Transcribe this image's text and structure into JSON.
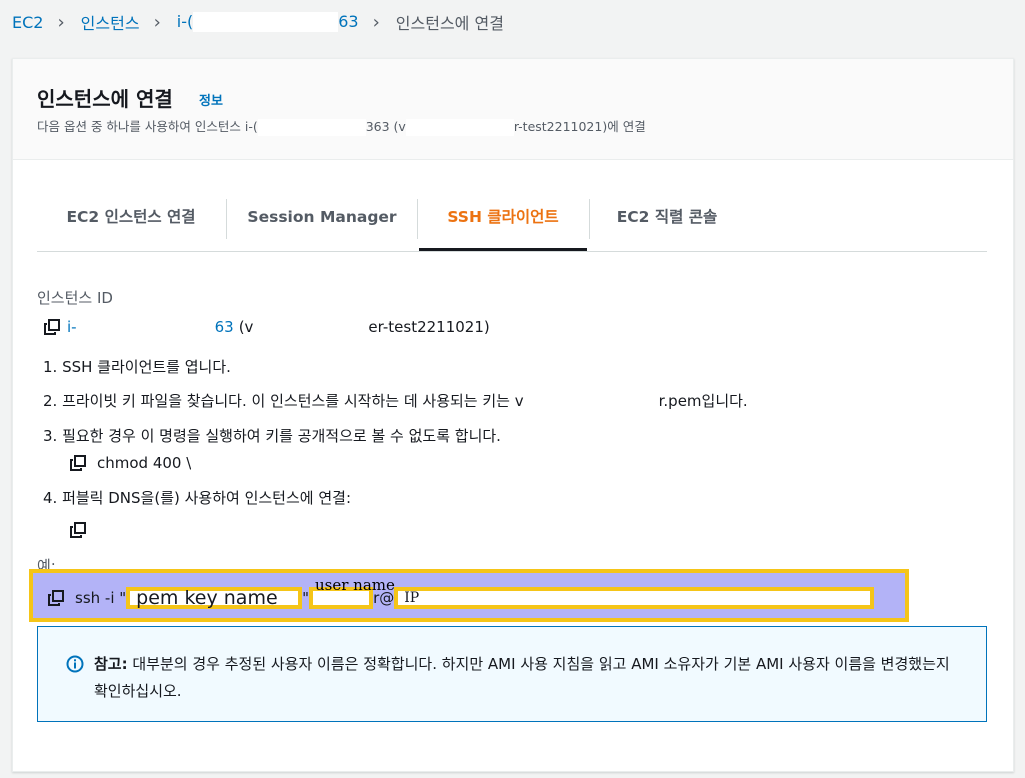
{
  "breadcrumb": {
    "ec2": "EC2",
    "instances": "인스턴스",
    "instance_id": "i-(",
    "instance_id_end": "63",
    "current": "인스턴스에 연결"
  },
  "header": {
    "title": "인스턴스에 연결",
    "info": "정보",
    "subtitle_start": "다음 옵션 중 하나를 사용하여 인스턴스 i-(",
    "subtitle_mid": "363 (v",
    "subtitle_end": "r-test2211021)에 연결"
  },
  "tabs": [
    {
      "label": "EC2 인스턴스 연결"
    },
    {
      "label": "Session Manager"
    },
    {
      "label": "SSH 클라이언트"
    },
    {
      "label": "EC2 직렬 콘솔"
    }
  ],
  "instance": {
    "label": "인스턴스 ID",
    "id_start": "i-",
    "id_end": "63",
    "name_start": "(v",
    "name_end": "er-test2211021)"
  },
  "steps": {
    "s1": "1. SSH 클라이언트를 엽니다.",
    "s2_start": "2. 프라이빗 키 파일을 찾습니다. 이 인스턴스를 시작하는 데 사용되는 키는 v",
    "s2_end": "r.pem입니다.",
    "s3": "3. 필요한 경우 이 명령을 실행하여 키를 공개적으로 볼 수 없도록 합니다.",
    "s3_cmd": "chmod 400 \\",
    "s4": "4. 퍼블릭 DNS을(를) 사용하여 인스턴스에 연결:"
  },
  "example": {
    "label": "예:",
    "ssh_prefix": "ssh -i \"",
    "pem_label": "pem key name",
    "quote_mid": "\"",
    "user_tail": "r@",
    "user_annotation": "user name",
    "ip_label": "IP"
  },
  "note": {
    "bold": "참고:",
    "text": " 대부분의 경우 추정된 사용자 이름은 정확합니다. 하지만 AMI 사용 지침을 읽고 AMI 소유자가 기본 AMI 사용자 이름을 변경했는지 확인하십시오."
  },
  "colors": {
    "link": "#0073bb",
    "active_tab": "#ec7211",
    "highlight": "#b3b3f7",
    "annotation_box": "#f5c518"
  }
}
